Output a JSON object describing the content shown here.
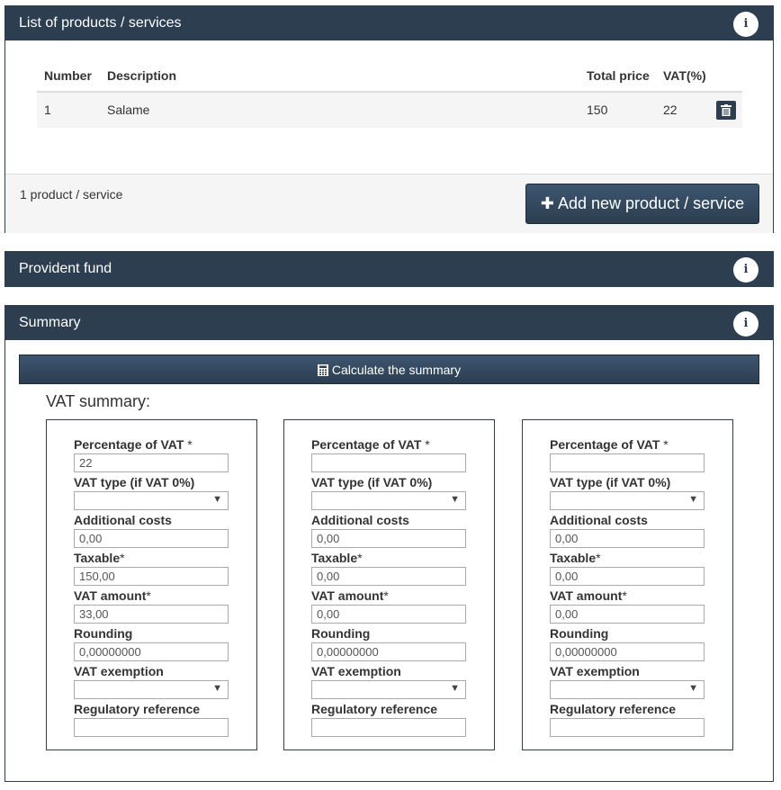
{
  "products": {
    "title": "List of products / services",
    "info_icon": "info-icon",
    "columns": [
      "Number",
      "Description",
      "Total price",
      "VAT(%)"
    ],
    "rows": [
      {
        "number": "1",
        "description": "Salame",
        "total_price": "150",
        "vat": "22"
      }
    ],
    "count_text": "1 product / service",
    "add_button": "Add new product / service"
  },
  "provident": {
    "title": "Provident fund"
  },
  "summary": {
    "title": "Summary",
    "calc_button": "Calculate the summary",
    "vat_title": "VAT summary:",
    "labels": {
      "percentage": "Percentage of VAT",
      "vat_type": "VAT type (if VAT 0%)",
      "additional_costs": "Additional costs",
      "taxable": "Taxable",
      "vat_amount": "VAT amount",
      "rounding": "Rounding",
      "exemption": "VAT exemption",
      "regulatory": "Regulatory reference",
      "required_mark": "*"
    },
    "boxes": [
      {
        "percentage": "22",
        "vat_type": "",
        "additional_costs": "0,00",
        "taxable": "150,00",
        "vat_amount": "33,00",
        "rounding": "0,00000000",
        "exemption": "",
        "regulatory": ""
      },
      {
        "percentage": "",
        "vat_type": "",
        "additional_costs": "0,00",
        "taxable": "0,00",
        "vat_amount": "0,00",
        "rounding": "0,00000000",
        "exemption": "",
        "regulatory": ""
      },
      {
        "percentage": "",
        "vat_type": "",
        "additional_costs": "0,00",
        "taxable": "0,00",
        "vat_amount": "0,00",
        "rounding": "0,00000000",
        "exemption": "",
        "regulatory": ""
      }
    ]
  },
  "colors": {
    "header_bg": "#2c3e50",
    "row_bg": "#f5f5f5"
  }
}
